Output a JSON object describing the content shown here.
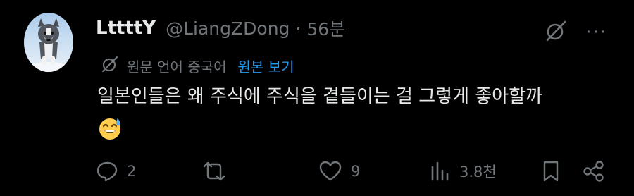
{
  "tweet": {
    "display_name": "LttttY",
    "handle": "@LiangZDong",
    "separator": "·",
    "time": "56분",
    "translation": {
      "original_language": "원문 언어 중국어",
      "view_original": "원본 보기"
    },
    "text": "일본인들은 왜 주식에 주식을 곁들이는 걸 그렇게 좋아할까",
    "emoji": "sweat-smile-emoji",
    "more_label": "···"
  },
  "actions": {
    "reply_count": "2",
    "retweet_count": "",
    "like_count": "9",
    "views_count": "3.8천"
  },
  "colors": {
    "background": "#000000",
    "text": "#e7e9ea",
    "muted": "#71767b",
    "link": "#1d9bf0"
  }
}
